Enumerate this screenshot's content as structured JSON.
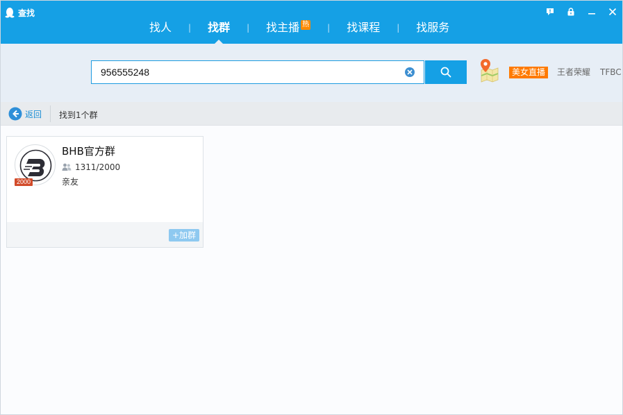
{
  "window": {
    "title": "查找"
  },
  "tabs": [
    {
      "label": "找人"
    },
    {
      "label": "找群",
      "active": true
    },
    {
      "label": "找主播",
      "badge": "热"
    },
    {
      "label": "找课程"
    },
    {
      "label": "找服务"
    }
  ],
  "tab_separator": "|",
  "search": {
    "value": "956555248",
    "placeholder": ""
  },
  "tags": {
    "live": "美女直播",
    "game": "王者荣耀",
    "extra": "TFBC"
  },
  "toolbar": {
    "back_label": "返回",
    "result_count": "找到1个群"
  },
  "results": [
    {
      "name": "BHB官方群",
      "members": "1311/2000",
      "category": "亲友",
      "level": "2000",
      "join_label": "+加群"
    }
  ],
  "colors": {
    "titlebar": "#15a0e5",
    "search_zone": "#e7eef6",
    "accent_orange": "#ff7a00",
    "join_button": "#8ec9f0",
    "level_badge": "#d24b2a"
  },
  "icons": {
    "app": "penguin-icon",
    "feedback": "feedback-icon",
    "lock": "lock-icon",
    "minimize": "minimize-icon",
    "close": "close-icon",
    "clear": "clear-icon",
    "search": "search-icon",
    "map": "map-pin-icon",
    "back": "back-arrow-icon",
    "members": "members-icon"
  }
}
